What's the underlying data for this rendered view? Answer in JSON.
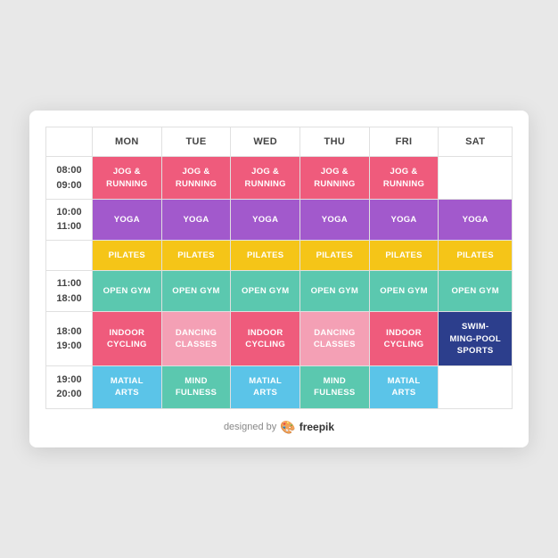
{
  "header": {
    "days": [
      "",
      "MON",
      "TUE",
      "WED",
      "THU",
      "FRI",
      "SAT"
    ]
  },
  "rows": [
    {
      "time": "08:00\n09:00",
      "classes": [
        {
          "label": "JOG &\nRUNNING",
          "color": "#EF5B7C"
        },
        {
          "label": "JOG &\nRUNNING",
          "color": "#EF5B7C"
        },
        {
          "label": "JOG &\nRUNNING",
          "color": "#EF5B7C"
        },
        {
          "label": "JOG &\nRUNNING",
          "color": "#EF5B7C"
        },
        {
          "label": "JOG &\nRUNNING",
          "color": "#EF5B7C"
        },
        {
          "label": "",
          "color": "#fff",
          "empty": true
        }
      ]
    },
    {
      "time": "10:00\n11:00",
      "classes": [
        {
          "label": "YOGA",
          "color": "#A259CC"
        },
        {
          "label": "YOGA",
          "color": "#A259CC"
        },
        {
          "label": "YOGA",
          "color": "#A259CC"
        },
        {
          "label": "YOGA",
          "color": "#A259CC"
        },
        {
          "label": "YOGA",
          "color": "#A259CC"
        },
        {
          "label": "YOGA",
          "color": "#A259CC"
        }
      ]
    },
    {
      "time": "",
      "classes": [
        {
          "label": "PILATES",
          "color": "#F5C518"
        },
        {
          "label": "PILATES",
          "color": "#F5C518"
        },
        {
          "label": "PILATES",
          "color": "#F5C518"
        },
        {
          "label": "PILATES",
          "color": "#F5C518"
        },
        {
          "label": "PILATES",
          "color": "#F5C518"
        },
        {
          "label": "PILATES",
          "color": "#F5C518"
        }
      ]
    },
    {
      "time": "11:00\n18:00",
      "classes": [
        {
          "label": "OPEN GYM",
          "color": "#5BC8AF"
        },
        {
          "label": "OPEN GYM",
          "color": "#5BC8AF"
        },
        {
          "label": "OPEN GYM",
          "color": "#5BC8AF"
        },
        {
          "label": "OPEN GYM",
          "color": "#5BC8AF"
        },
        {
          "label": "OPEN GYM",
          "color": "#5BC8AF"
        },
        {
          "label": "OPEN GYM",
          "color": "#5BC8AF"
        }
      ]
    },
    {
      "time": "18:00\n19:00",
      "classes": [
        {
          "label": "INDOOR\nCYCLING",
          "color": "#EF5B7C"
        },
        {
          "label": "DANCING\nCLASSES",
          "color": "#F4A0B5"
        },
        {
          "label": "INDOOR\nCYCLING",
          "color": "#EF5B7C"
        },
        {
          "label": "DANCING\nCLASSES",
          "color": "#F4A0B5"
        },
        {
          "label": "INDOOR\nCYCLING",
          "color": "#EF5B7C"
        },
        {
          "label": "SWIM-\nMING-POOL\nSPORTS",
          "color": "#2C3E8C"
        }
      ]
    },
    {
      "time": "19:00\n20:00",
      "classes": [
        {
          "label": "MATIAL\nARTS",
          "color": "#5BC4E8"
        },
        {
          "label": "MIND\nFULNESS",
          "color": "#5BC8AF"
        },
        {
          "label": "MATIAL\nARTS",
          "color": "#5BC4E8"
        },
        {
          "label": "MIND\nFULNESS",
          "color": "#5BC8AF"
        },
        {
          "label": "MATIAL\nARTS",
          "color": "#5BC4E8"
        },
        {
          "label": "",
          "color": "#fff",
          "empty": true
        }
      ]
    }
  ],
  "footer": {
    "designed_by": "designed by",
    "brand": "freepik"
  }
}
